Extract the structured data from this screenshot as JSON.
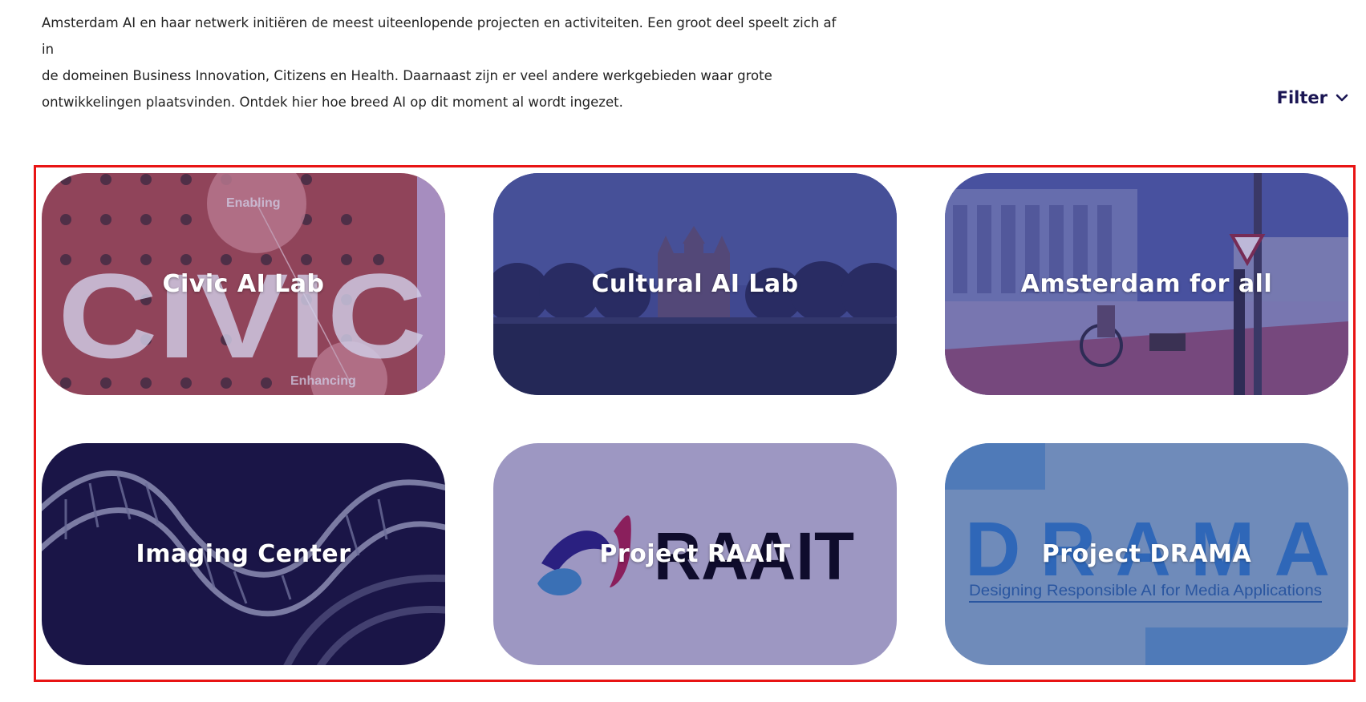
{
  "intro": {
    "line1": "Amsterdam AI en haar netwerk initiëren de meest uiteenlopende projecten en activiteiten. Een groot deel speelt zich af in",
    "line2": "de domeinen Business Innovation, Citizens en Health. Daarnaast zijn er veel andere werkgebieden waar grote",
    "line3": "ontwikkelingen plaatsvinden. Ontdek hier hoe breed AI op dit moment al wordt ingezet."
  },
  "filter": {
    "label": "Filter",
    "icon": "chevron-down-icon"
  },
  "cards": [
    {
      "title": "Civic AI Lab",
      "image_text_top": "Enabling",
      "image_text_big": "CIVIC",
      "image_text_bottom": "Enhancing"
    },
    {
      "title": "Cultural AI Lab"
    },
    {
      "title": "Amsterdam for all"
    },
    {
      "title": "Imaging Center"
    },
    {
      "title": "Project RAAIT",
      "image_text": "RAAIT"
    },
    {
      "title": "Project DRAMA",
      "image_text": "DRAMA",
      "image_subtext": "Designing Responsible AI for Media Applications"
    }
  ],
  "colors": {
    "overlay_purple": "#2b2a7a",
    "card_lavender": "#9d97c2",
    "drama_blue": "#6f8bba",
    "imaging_navy": "#1a1547",
    "filter_text": "#1a1553",
    "highlight_border": "#e81414"
  }
}
